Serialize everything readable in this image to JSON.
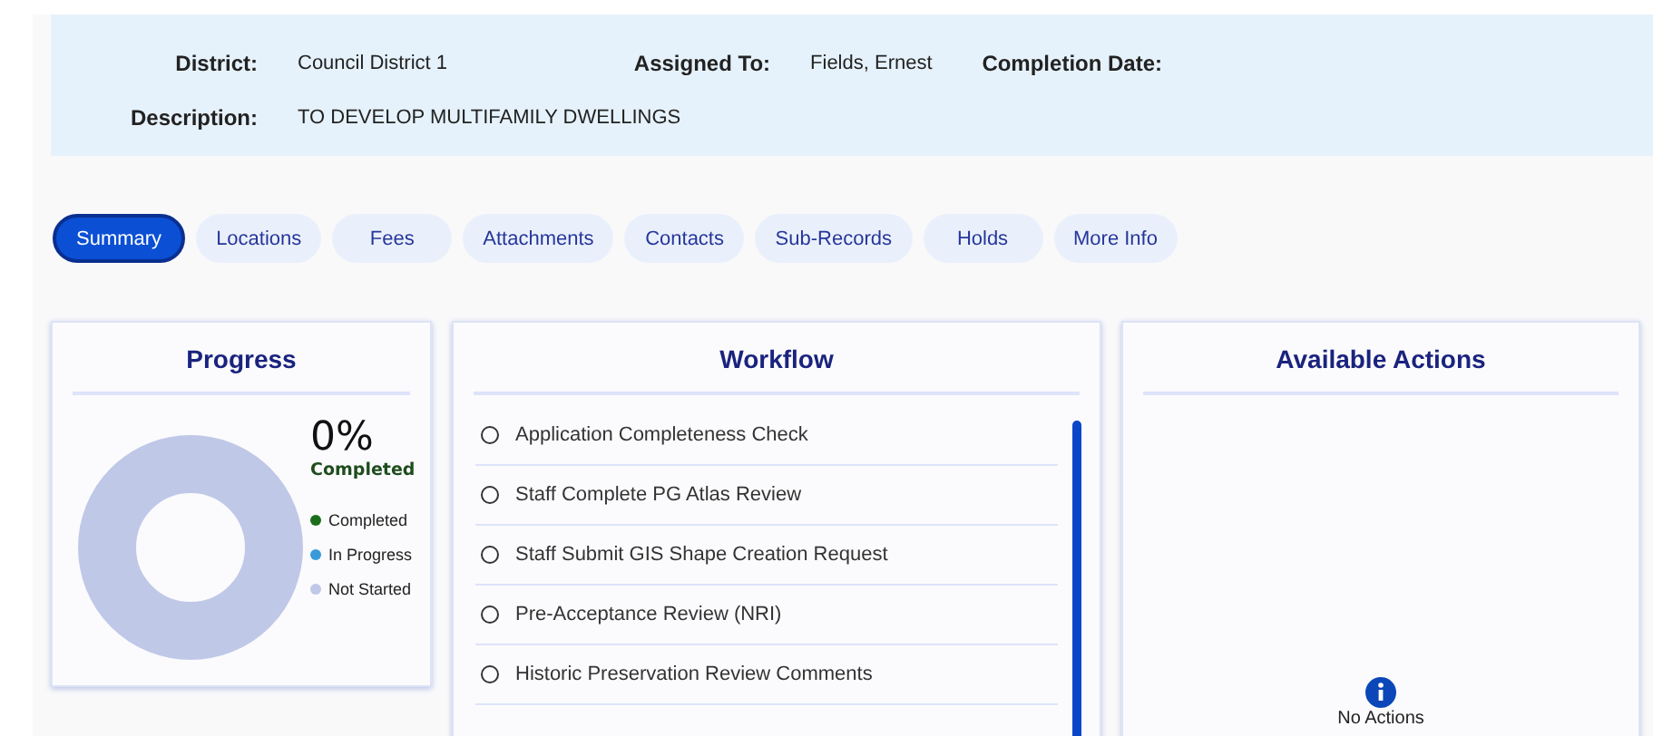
{
  "details": [
    [
      {
        "label": "District:",
        "value": "Council District 1"
      },
      {
        "label": "Assigned To:",
        "value": "Fields, Ernest"
      },
      {
        "label": "Completion Date:"
      }
    ],
    [
      {
        "label": "Description:",
        "value": "TO DEVELOP MULTIFAMILY DWELLINGS"
      }
    ]
  ],
  "tabs": [
    {
      "label": "Summary",
      "selected": true
    },
    {
      "label": "Locations",
      "selected": false
    },
    {
      "label": "Fees",
      "selected": false
    },
    {
      "label": "Attachments",
      "selected": false
    },
    {
      "label": "Contacts",
      "selected": false
    },
    {
      "label": "Sub-Records",
      "selected": false
    },
    {
      "label": "Holds",
      "selected": false
    },
    {
      "label": "More Info",
      "selected": false
    }
  ],
  "progress": {
    "title": "Progress",
    "percent": "0%",
    "percent_label": "Completed",
    "legend": [
      {
        "label": "Completed",
        "color": "#1b6e1b"
      },
      {
        "label": "In Progress",
        "color": "#3a9ad9"
      },
      {
        "label": "Not Started",
        "color": "#c0c8e8"
      }
    ]
  },
  "workflow": {
    "title": "Workflow",
    "items": [
      {
        "label": "Application Completeness Check",
        "done": false
      },
      {
        "label": "Staff Complete PG Atlas Review",
        "done": false
      },
      {
        "label": "Staff Submit GIS Shape Creation Request",
        "done": false
      },
      {
        "label": "Pre-Acceptance Review (NRI)",
        "done": false
      },
      {
        "label": "Historic Preservation Review Comments",
        "done": false
      }
    ]
  },
  "actions": {
    "title": "Available Actions",
    "empty_text": "No Actions"
  }
}
